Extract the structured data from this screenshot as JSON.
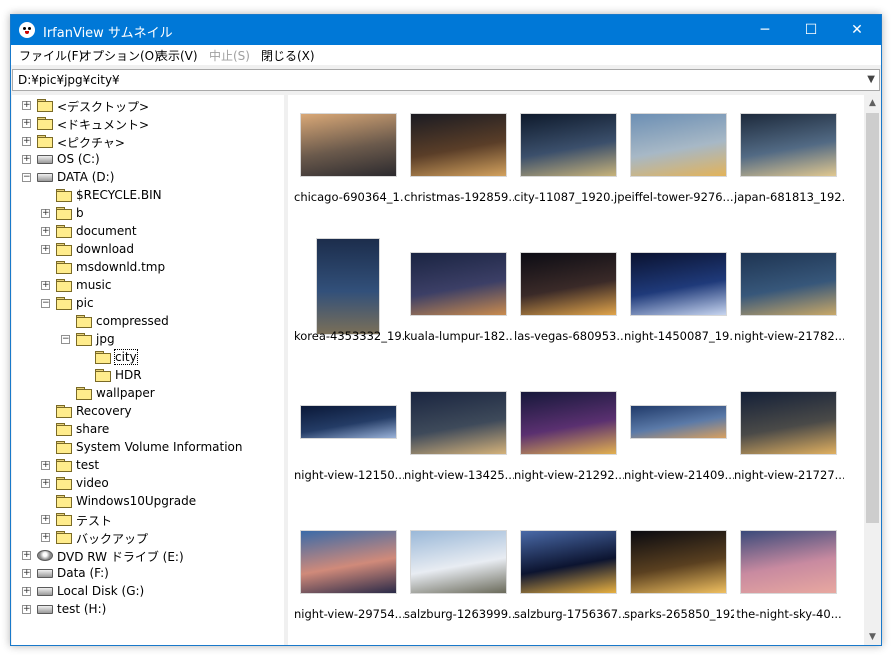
{
  "window": {
    "title": "IrfanView サムネイル",
    "minimize": "─",
    "maximize": "☐",
    "close": "✕"
  },
  "menu": [
    {
      "label": "ファイル(F)",
      "disabled": false
    },
    {
      "label": "オプション(O)",
      "disabled": false
    },
    {
      "label": "表示(V)",
      "disabled": false
    },
    {
      "label": "中止(S)",
      "disabled": true
    },
    {
      "label": "閉じる(X)",
      "disabled": false
    }
  ],
  "path": {
    "value": "D:¥pic¥jpg¥city¥",
    "dropdown_icon": "chevron-down-icon"
  },
  "tree": [
    {
      "label": "<デスクトップ>",
      "depth": 0,
      "kind": "folder",
      "exp": "+"
    },
    {
      "label": "<ドキュメント>",
      "depth": 0,
      "kind": "folder",
      "exp": "+"
    },
    {
      "label": "<ピクチャ>",
      "depth": 0,
      "kind": "folder",
      "exp": "+"
    },
    {
      "label": "OS (C:)",
      "depth": 0,
      "kind": "drive",
      "exp": "+"
    },
    {
      "label": "DATA (D:)",
      "depth": 0,
      "kind": "drive",
      "exp": "-"
    },
    {
      "label": "$RECYCLE.BIN",
      "depth": 1,
      "kind": "folder",
      "exp": ""
    },
    {
      "label": "b",
      "depth": 1,
      "kind": "folder",
      "exp": "+"
    },
    {
      "label": "document",
      "depth": 1,
      "kind": "folder",
      "exp": "+"
    },
    {
      "label": "download",
      "depth": 1,
      "kind": "folder",
      "exp": "+"
    },
    {
      "label": "msdownld.tmp",
      "depth": 1,
      "kind": "folder",
      "exp": ""
    },
    {
      "label": "music",
      "depth": 1,
      "kind": "folder",
      "exp": "+"
    },
    {
      "label": "pic",
      "depth": 1,
      "kind": "folder",
      "exp": "-"
    },
    {
      "label": "compressed",
      "depth": 2,
      "kind": "folder",
      "exp": ""
    },
    {
      "label": "jpg",
      "depth": 2,
      "kind": "folder",
      "exp": "-"
    },
    {
      "label": "city",
      "depth": 3,
      "kind": "folder-open",
      "exp": "",
      "selected": true
    },
    {
      "label": "HDR",
      "depth": 3,
      "kind": "folder",
      "exp": ""
    },
    {
      "label": "wallpaper",
      "depth": 2,
      "kind": "folder",
      "exp": ""
    },
    {
      "label": "Recovery",
      "depth": 1,
      "kind": "folder",
      "exp": ""
    },
    {
      "label": "share",
      "depth": 1,
      "kind": "folder",
      "exp": ""
    },
    {
      "label": "System Volume Information",
      "depth": 1,
      "kind": "folder",
      "exp": ""
    },
    {
      "label": "test",
      "depth": 1,
      "kind": "folder",
      "exp": "+"
    },
    {
      "label": "video",
      "depth": 1,
      "kind": "folder",
      "exp": "+"
    },
    {
      "label": "Windows10Upgrade",
      "depth": 1,
      "kind": "folder",
      "exp": ""
    },
    {
      "label": "テスト",
      "depth": 1,
      "kind": "folder",
      "exp": "+"
    },
    {
      "label": "バックアップ",
      "depth": 1,
      "kind": "folder",
      "exp": "+"
    },
    {
      "label": "DVD RW ドライブ (E:)",
      "depth": 0,
      "kind": "dvd",
      "exp": "+"
    },
    {
      "label": "Data (F:)",
      "depth": 0,
      "kind": "drive",
      "exp": "+"
    },
    {
      "label": "Local Disk (G:)",
      "depth": 0,
      "kind": "drive",
      "exp": "+"
    },
    {
      "label": "test (H:)",
      "depth": 0,
      "kind": "drive",
      "exp": "+"
    }
  ],
  "thumbnails": [
    {
      "name": "chicago-690364_1...",
      "shape": "wide",
      "colors": [
        "#d9a877",
        "#6b5a4c",
        "#2c2a2e"
      ]
    },
    {
      "name": "christmas-192859...",
      "shape": "wide",
      "colors": [
        "#1b1b22",
        "#5a3e28",
        "#d3a25e"
      ]
    },
    {
      "name": "city-11087_1920.jpg",
      "shape": "wide",
      "colors": [
        "#0e1a2c",
        "#3b4f6b",
        "#c7b37a"
      ]
    },
    {
      "name": "eiffel-tower-9276...",
      "shape": "wide",
      "colors": [
        "#6c8fb4",
        "#a7b8c6",
        "#e2b35a"
      ]
    },
    {
      "name": "japan-681813_192...",
      "shape": "wide",
      "colors": [
        "#1d2a3c",
        "#526a84",
        "#e0c890"
      ]
    },
    {
      "name": "korea-4353332_19...",
      "shape": "tall",
      "colors": [
        "#1c2d4c",
        "#32507a",
        "#7a6f58"
      ]
    },
    {
      "name": "kuala-lumpur-182...",
      "shape": "wide",
      "colors": [
        "#1a2442",
        "#3c3f66",
        "#c98b4e"
      ]
    },
    {
      "name": "las-vegas-680953...",
      "shape": "wide",
      "colors": [
        "#0c0c14",
        "#3a2a28",
        "#e0a44a"
      ]
    },
    {
      "name": "night-1450087_19...",
      "shape": "wide",
      "colors": [
        "#0a1230",
        "#1f3a7a",
        "#c7d5f0"
      ]
    },
    {
      "name": "night-view-21782...",
      "shape": "wide",
      "colors": [
        "#1e3452",
        "#37577a",
        "#c8a868"
      ]
    },
    {
      "name": "night-view-12150...",
      "shape": "pano",
      "colors": [
        "#0a1838",
        "#243c66",
        "#9ab2d8"
      ]
    },
    {
      "name": "night-view-13425...",
      "shape": "wide",
      "colors": [
        "#1a2540",
        "#3e4a5a",
        "#d4b27a"
      ]
    },
    {
      "name": "night-view-21292...",
      "shape": "wide",
      "colors": [
        "#16183a",
        "#5a3070",
        "#e2b050"
      ]
    },
    {
      "name": "night-view-21409...",
      "shape": "pano",
      "colors": [
        "#203a6a",
        "#5b7aa8",
        "#d8a060"
      ]
    },
    {
      "name": "night-view-21727...",
      "shape": "wide",
      "colors": [
        "#142038",
        "#4a4a48",
        "#e0b060"
      ]
    },
    {
      "name": "night-view-29754...",
      "shape": "wide",
      "colors": [
        "#3a6aa8",
        "#d08a7a",
        "#2a2a48"
      ]
    },
    {
      "name": "salzburg-1263999...",
      "shape": "wide",
      "colors": [
        "#9ab8d8",
        "#e8ecf2",
        "#6a6a5a"
      ]
    },
    {
      "name": "salzburg-1756367...",
      "shape": "wide",
      "colors": [
        "#4a6aa8",
        "#0c1430",
        "#e8b040"
      ]
    },
    {
      "name": "sparks-265850_192...",
      "shape": "wide",
      "colors": [
        "#0a0a10",
        "#5a4020",
        "#f0c060"
      ]
    },
    {
      "name": "the-night-sky-40...",
      "shape": "wide",
      "colors": [
        "#3a4a7a",
        "#c88aa0",
        "#e8a8a0"
      ]
    }
  ],
  "scrollbar": {
    "up_icon": "▲",
    "down_icon": "▼"
  }
}
